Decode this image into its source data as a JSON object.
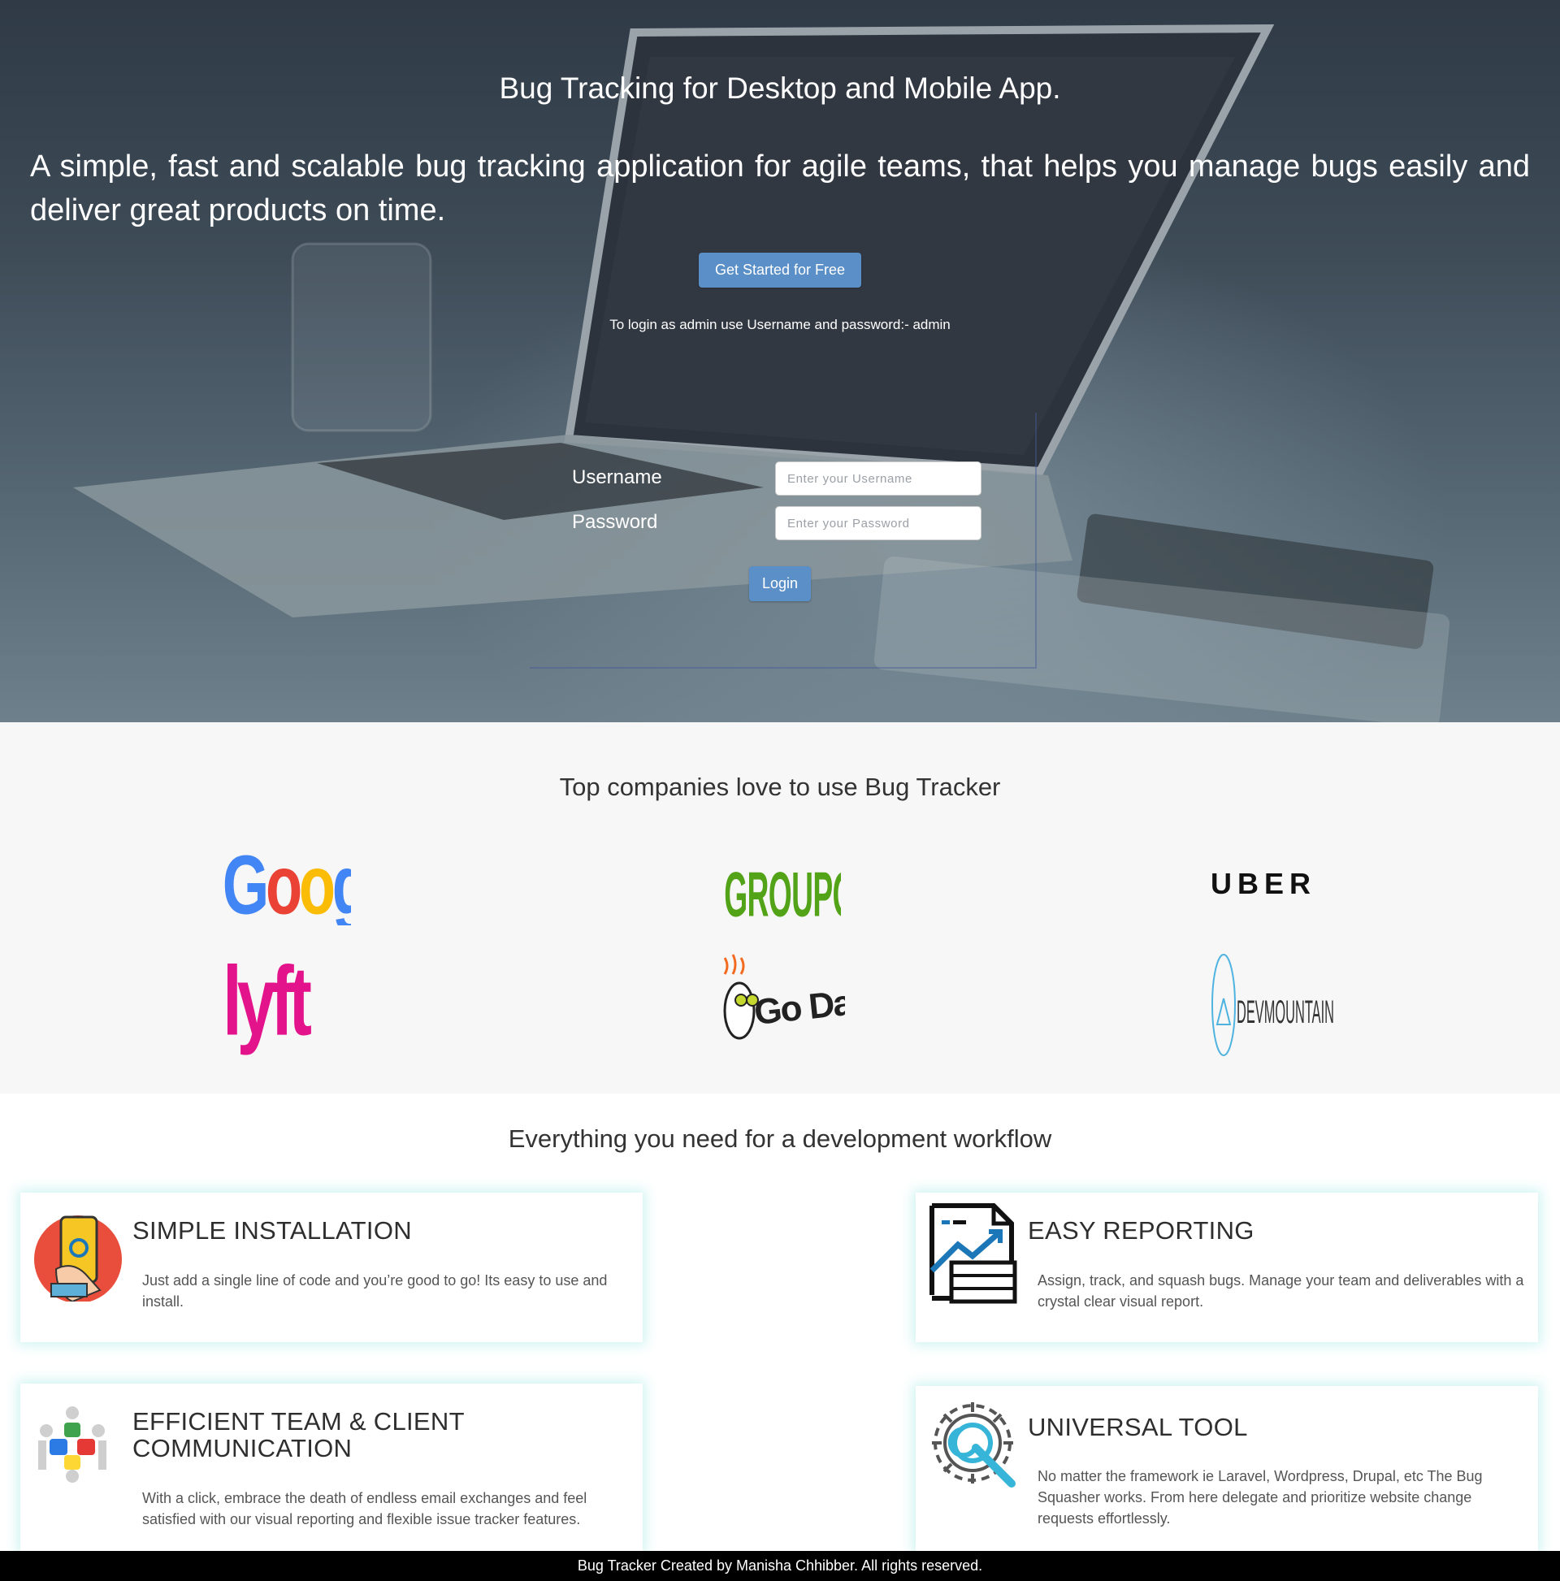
{
  "hero": {
    "title": "Bug Tracking for Desktop and Mobile App.",
    "subtitle": "A simple, fast and scalable bug tracking application for agile teams, that helps you manage bugs easily and deliver great products on time.",
    "cta_label": "Get Started for Free",
    "login_hint": "To login as admin use Username and password:- admin"
  },
  "login": {
    "username_label": "Username",
    "username_placeholder": "Enter your Username",
    "password_label": "Password",
    "password_placeholder": "Enter your Password",
    "submit_label": "Login"
  },
  "companies": {
    "title": "Top companies love to use Bug Tracker",
    "logos": [
      "Google",
      "GROUPON",
      "UBER",
      "lyft",
      "Go Daddy",
      "DEVMOUNTAIN"
    ]
  },
  "features": {
    "title": "Everything you need for a development workflow",
    "cards": [
      {
        "title": "SIMPLE INSTALLATION",
        "text": "Just add a single line of code and you’re good to go! Its easy to use and install.",
        "icon": "phone-touch-icon"
      },
      {
        "title": "EASY REPORTING",
        "text": "Assign, track, and squash bugs. Manage your team and deliverables with a crystal clear visual report.",
        "icon": "report-chart-icon"
      },
      {
        "title": "EFFICIENT TEAM & CLIENT COMMUNICATION",
        "text": "With a click, embrace the death of endless email exchanges and feel satisfied with our visual reporting and flexible issue tracker features.",
        "icon": "team-puzzle-icon"
      },
      {
        "title": "UNIVERSAL TOOL",
        "text": "No matter the framework ie Laravel, Wordpress, Drupal, etc The Bug Squasher works. From here delegate and prioritize website change requests effortlessly.",
        "icon": "gear-wrench-icon"
      }
    ]
  },
  "footer": {
    "text": "Bug Tracker Created by Manisha Chhibber. All rights reserved."
  },
  "colors": {
    "primary_button": "#5a8fc7",
    "companies_bg": "#f7f7f7",
    "card_glow": "#96e6e1",
    "footer_bg": "#000000"
  }
}
